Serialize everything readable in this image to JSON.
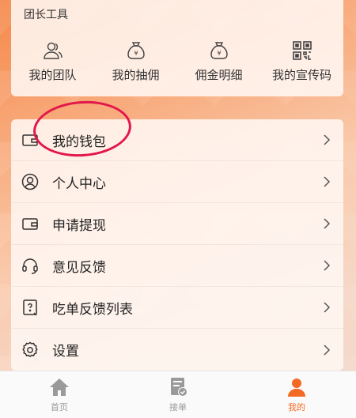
{
  "tools": {
    "title": "团长工具",
    "items": [
      {
        "label": "我的团队",
        "icon": "team-icon"
      },
      {
        "label": "我的抽佣",
        "icon": "money-bag-icon"
      },
      {
        "label": "佣金明细",
        "icon": "money-bag-icon"
      },
      {
        "label": "我的宣传码",
        "icon": "qr-code-icon"
      }
    ]
  },
  "menu": {
    "items": [
      {
        "label": "我的钱包",
        "icon": "wallet-icon"
      },
      {
        "label": "个人中心",
        "icon": "user-circle-icon"
      },
      {
        "label": "申请提现",
        "icon": "wallet-icon"
      },
      {
        "label": "意见反馈",
        "icon": "headset-icon"
      },
      {
        "label": "吃单反馈列表",
        "icon": "feedback-list-icon"
      },
      {
        "label": "设置",
        "icon": "gear-icon"
      }
    ]
  },
  "tabbar": {
    "items": [
      {
        "label": "首页",
        "icon": "home-icon"
      },
      {
        "label": "接单",
        "icon": "order-icon"
      },
      {
        "label": "我的",
        "icon": "person-icon"
      }
    ],
    "active_index": 2
  },
  "colors": {
    "accent": "#f36a25",
    "highlight_circle": "#e2174a",
    "inactive_tab": "#999999"
  }
}
